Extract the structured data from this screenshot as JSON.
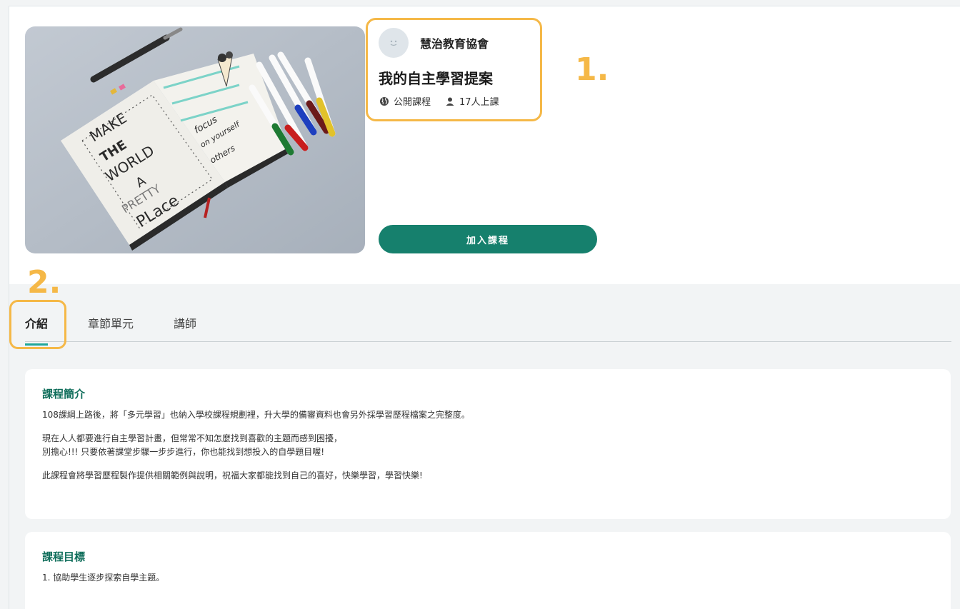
{
  "organization": {
    "name": "慧治教育協會"
  },
  "course": {
    "title": "我的自主學習提案",
    "visibility": "公開課程",
    "enrolled": "17人上課",
    "join_label": "加入課程"
  },
  "annotations": {
    "first": "1.",
    "second": "2."
  },
  "tabs": [
    "介紹",
    "章節單元",
    "講師"
  ],
  "intro": {
    "heading": "課程簡介",
    "paragraphs": [
      "108課綱上路後，將「多元學習」也納入學校課程規劃裡，升大學的備審資料也會另外採學習歷程檔案之完整度。",
      "現在人人都要進行自主學習計畫，但常常不知怎麼找到喜歡的主題而感到困擾，",
      "別擔心!!! 只要依著課堂步驟一步步進行，你也能找到想投入的自學題目喔!",
      "此課程會將學習歷程製作提供相關範例與說明，祝福大家都能找到自己的喜好，快樂學習，學習快樂!"
    ]
  },
  "goals": {
    "heading": "課程目標",
    "items": [
      "1. 協助學生逐步探索自學主題。"
    ]
  },
  "cover_text": {
    "line1": "MAKE",
    "line2": "THE",
    "line3": "WORLD",
    "line4": "A",
    "line5": "PRETTY",
    "line6": "PLace",
    "script1": "focus",
    "script2": "on yourself",
    "script3": "others"
  },
  "colors": {
    "accent": "#16806d",
    "annotation": "#f5b847",
    "heading": "#0e6d5a"
  }
}
